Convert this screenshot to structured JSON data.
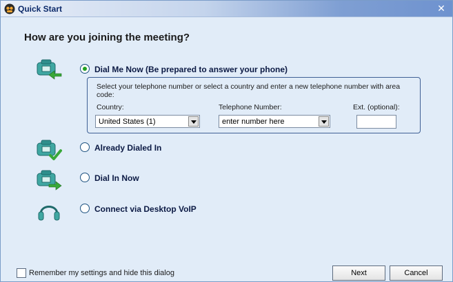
{
  "window": {
    "title": "Quick Start"
  },
  "question": "How are you joining the meeting?",
  "options": [
    {
      "label": "Dial Me Now (Be prepared to answer your phone)",
      "selected": true,
      "icon": "phone-arrow-left-icon"
    },
    {
      "label": "Already Dialed In",
      "selected": false,
      "icon": "phone-check-icon"
    },
    {
      "label": "Dial In Now",
      "selected": false,
      "icon": "phone-arrow-right-icon"
    },
    {
      "label": "Connect via Desktop VoIP",
      "selected": false,
      "icon": "headset-icon"
    }
  ],
  "dial_me": {
    "instructions": "Select your telephone number or select a country and enter a new telephone number with area code:",
    "country_label": "Country:",
    "country_value": "United States (1)",
    "phone_label": "Telephone Number:",
    "phone_value": "enter number here",
    "ext_label": "Ext. (optional):",
    "ext_value": ""
  },
  "footer": {
    "remember_label": "Remember my settings and hide this dialog",
    "remember_checked": false,
    "next_label": "Next",
    "cancel_label": "Cancel"
  },
  "colors": {
    "accent": "#21a121",
    "title_text": "#0c2a6a",
    "background": "#e1ecf8"
  }
}
